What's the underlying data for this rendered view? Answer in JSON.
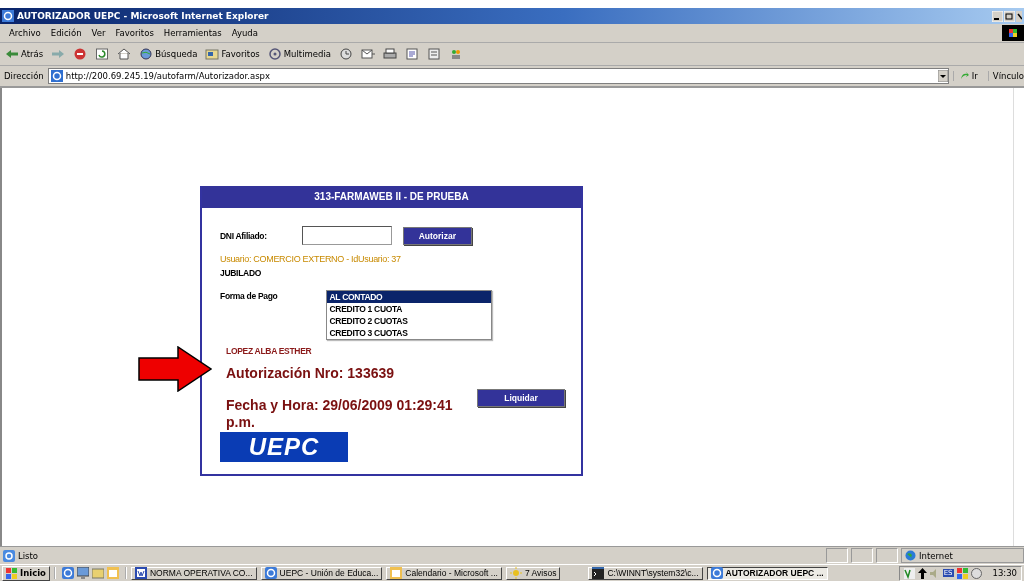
{
  "window": {
    "title": "AUTORIZADOR UEPC - Microsoft Internet Explorer"
  },
  "menu": [
    "Archivo",
    "Edición",
    "Ver",
    "Favoritos",
    "Herramientas",
    "Ayuda"
  ],
  "toolbar": [
    {
      "kind": "back",
      "label": "Atrás"
    },
    {
      "kind": "forward"
    },
    {
      "kind": "stop"
    },
    {
      "kind": "refresh"
    },
    {
      "kind": "home"
    },
    {
      "kind": "search",
      "label": "Búsqueda"
    },
    {
      "kind": "favorites",
      "label": "Favoritos"
    },
    {
      "kind": "media",
      "label": "Multimedia"
    },
    {
      "kind": "history"
    },
    {
      "kind": "mail"
    },
    {
      "kind": "print"
    },
    {
      "kind": "edit"
    },
    {
      "kind": "discuss"
    },
    {
      "kind": "messenger"
    }
  ],
  "address_bar": {
    "label": "Dirección",
    "url": "http://200.69.245.19/autofarm/Autorizador.aspx",
    "go": "Ir",
    "links": "Vínculo"
  },
  "form": {
    "header": "313-FARMAWEB II - DE PRUEBA",
    "dni_label": "DNI Afiliado:",
    "authorize_button": "Autorizar",
    "user_info": "Usuario: COMERCIO EXTERNO - IdUsuario: 37",
    "category": "JUBILADO",
    "payment_label": "Forma de Pago",
    "payment_options": [
      {
        "label": "AL CONTADO",
        "selected": true
      },
      {
        "label": "CREDITO 1 CUOTA",
        "selected": false
      },
      {
        "label": "CREDITO 2 CUOTAS",
        "selected": false
      },
      {
        "label": "CREDITO 3 CUOTAS",
        "selected": false
      }
    ],
    "member_name": "LOPEZ ALBA ESTHER",
    "authorization": "Autorización Nro: 133639",
    "datetime": "Fecha y Hora: 29/06/2009 01:29:41 p.m.",
    "settle_button": "Liquidar",
    "logo": "UEPC"
  },
  "status_bar": {
    "text": "Listo",
    "zone": "Internet"
  },
  "taskbar": {
    "start": "Inicio",
    "tasks": [
      {
        "kind": "word",
        "label": "NORMA OPERATIVA CO...",
        "selected": false
      },
      {
        "kind": "browser",
        "label": "UEPC - Unión de Educa...",
        "selected": false
      },
      {
        "kind": "calendar",
        "label": "Calendario - Microsoft ...",
        "selected": false
      },
      {
        "kind": "alert",
        "label": "7 Avisos",
        "selected": false
      },
      {
        "kind": "console",
        "label": "C:\\WINNT\\system32\\c...",
        "selected": false
      },
      {
        "kind": "browser",
        "label": "AUTORIZADOR UEPC ...",
        "selected": true
      }
    ],
    "language": "ES",
    "clock": "13:30"
  }
}
